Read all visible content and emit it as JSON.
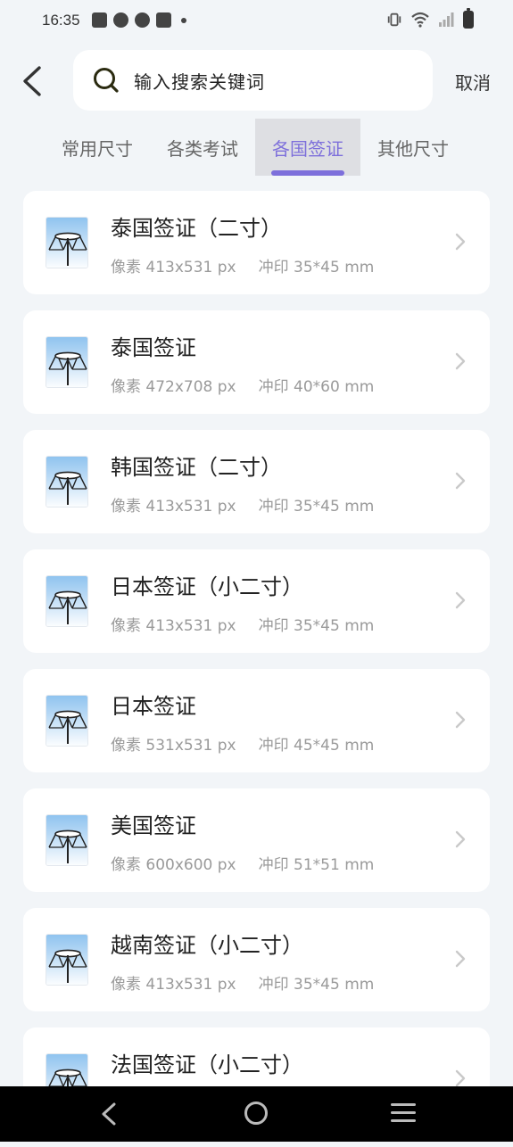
{
  "status_bar": {
    "time": "16:35",
    "icons_left": [
      "mail-icon",
      "steam-icon",
      "steam-icon",
      "mail-icon",
      "dot-icon"
    ],
    "icons_right": [
      "vibrate-icon",
      "wifi-icon",
      "signal-icon",
      "battery-icon"
    ]
  },
  "header": {
    "back_icon": "chevron-left-icon",
    "search_placeholder": "输入搜索关键词",
    "cancel_label": "取消"
  },
  "tabs": [
    {
      "label": "常用尺寸",
      "active": false
    },
    {
      "label": "各类考试",
      "active": false
    },
    {
      "label": "各国签证",
      "active": true
    },
    {
      "label": "其他尺寸",
      "active": false
    }
  ],
  "colors": {
    "accent": "#7d6fdb",
    "background": "#f2f5f8",
    "card": "#ffffff",
    "meta_text": "#9a9a9a"
  },
  "items": [
    {
      "title": "泰国签证（二寸）",
      "pixels": "像素 413x531 px",
      "print": "冲印 35*45 mm"
    },
    {
      "title": "泰国签证",
      "pixels": "像素 472x708 px",
      "print": "冲印 40*60 mm"
    },
    {
      "title": "韩国签证（二寸）",
      "pixels": "像素 413x531 px",
      "print": "冲印 35*45 mm"
    },
    {
      "title": "日本签证（小二寸）",
      "pixels": "像素 413x531 px",
      "print": "冲印 35*45 mm"
    },
    {
      "title": "日本签证",
      "pixels": "像素 531x531 px",
      "print": "冲印 45*45 mm"
    },
    {
      "title": "美国签证",
      "pixels": "像素 600x600 px",
      "print": "冲印 51*51 mm"
    },
    {
      "title": "越南签证（小二寸）",
      "pixels": "像素 413x531 px",
      "print": "冲印 35*45 mm"
    },
    {
      "title": "法国签证（小二寸）",
      "pixels": "",
      "print": ""
    }
  ],
  "nav_bar": {
    "back": "nav-back-icon",
    "home": "nav-home-icon",
    "recents": "nav-menu-icon"
  }
}
